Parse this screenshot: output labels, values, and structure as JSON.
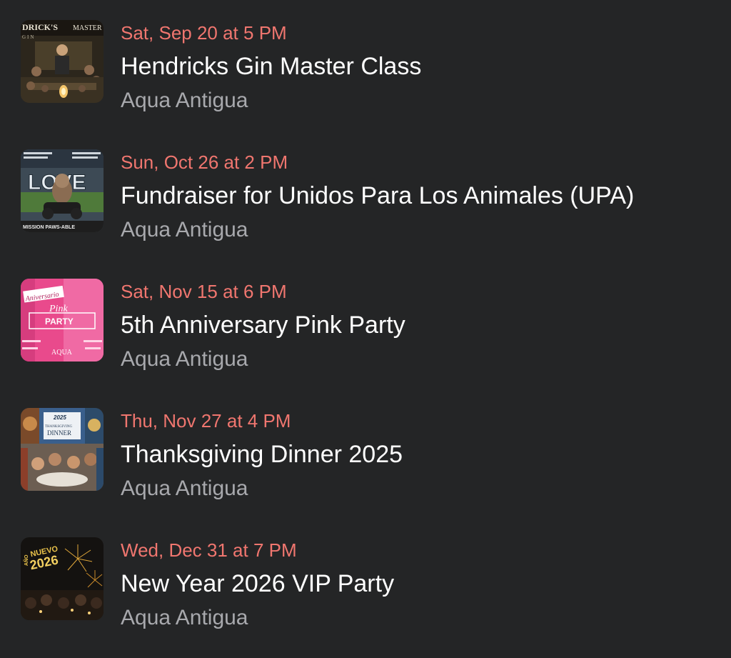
{
  "events": [
    {
      "date": "Sat, Sep 20 at 5 PM",
      "title": "Hendricks Gin Master Class",
      "venue": "Aqua Antigua",
      "thumb_icon": "gin-masterclass-photo",
      "thumb_text_a": "DRICK'S",
      "thumb_text_b": "MASTER",
      "thumb_text_c": "GIN"
    },
    {
      "date": "Sun, Oct 26 at 2 PM",
      "title": "Fundraiser for Unidos Para Los Animales (UPA)",
      "venue": "Aqua Antigua",
      "thumb_icon": "love-dog-poster",
      "thumb_text_a": "LOVE",
      "thumb_text_b": "MISSION PAWS-ABLE"
    },
    {
      "date": "Sat, Nov 15 at 6 PM",
      "title": "5th Anniversary Pink Party",
      "venue": "Aqua Antigua",
      "thumb_icon": "pink-party-poster",
      "thumb_text_a": "Aniversario",
      "thumb_text_b": "Pink",
      "thumb_text_c": "PARTY",
      "thumb_text_d": "AQUA"
    },
    {
      "date": "Thu, Nov 27 at 4 PM",
      "title": "Thanksgiving Dinner 2025",
      "venue": "Aqua Antigua",
      "thumb_icon": "thanksgiving-collage",
      "thumb_text_a": "2025",
      "thumb_text_b": "THANKSGIVING",
      "thumb_text_c": "DINNER"
    },
    {
      "date": "Wed, Dec 31 at 7 PM",
      "title": "New Year 2026 VIP Party",
      "venue": "Aqua Antigua",
      "thumb_icon": "fireworks-party-photo",
      "thumb_text_a": "AÑO",
      "thumb_text_b": "NUEVO",
      "thumb_text_c": "2026"
    }
  ],
  "colors": {
    "background": "#242526",
    "date": "#f0766f",
    "title": "#ffffff",
    "venue": "#a8a9ad"
  }
}
